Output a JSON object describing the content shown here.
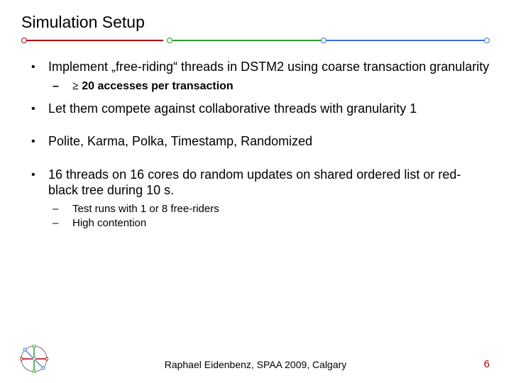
{
  "title": "Simulation Setup",
  "colors": {
    "red": "#b00000",
    "green": "#2aa02a",
    "blue": "#3a6fd8"
  },
  "bullets": {
    "b1_1": "Implement „free-riding“ threads in DSTM2 using coarse transaction granularity",
    "b1_1_sub1_prefix": "≥",
    "b1_1_sub1_rest": " 20 accesses per transaction",
    "b1_2": "Let them compete against collaborative threads with granularity 1",
    "b1_3": "Polite, Karma, Polka, Timestamp, Randomized",
    "b1_4": "16 threads on 16 cores do random updates on shared ordered list or red-black tree during 10 s.",
    "b1_4_sub1": "Test runs with 1 or 8 free-riders",
    "b1_4_sub2": "High contention"
  },
  "footer": "Raphael Eidenbenz,  SPAA 2009, Calgary",
  "page": "6"
}
